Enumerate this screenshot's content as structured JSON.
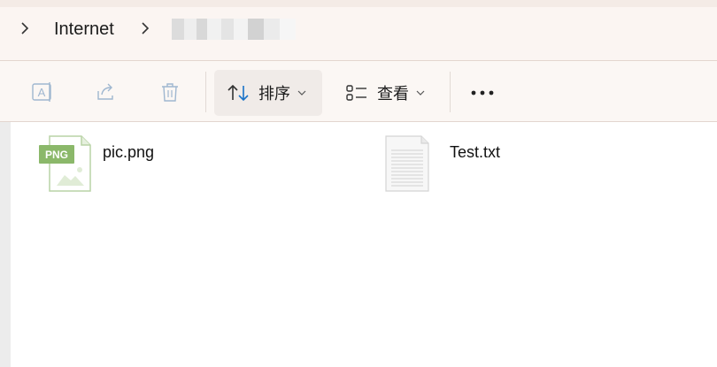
{
  "breadcrumb": {
    "items": [
      {
        "label": "Internet"
      },
      {
        "label": ""
      }
    ]
  },
  "toolbar": {
    "rename_icon": "rename-icon",
    "share_icon": "share-icon",
    "delete_icon": "trash-icon",
    "sort_label": "排序",
    "view_label": "查看",
    "more_icon": "more-icon"
  },
  "files": [
    {
      "name": "pic.png",
      "type_badge": "PNG",
      "icon": "png-file-icon"
    },
    {
      "name": "Test.txt",
      "icon": "text-file-icon"
    }
  ],
  "colors": {
    "accent_blue": "#1a73c8",
    "png_green": "#8bb86a",
    "disabled_icon": "#9fb7d0"
  }
}
